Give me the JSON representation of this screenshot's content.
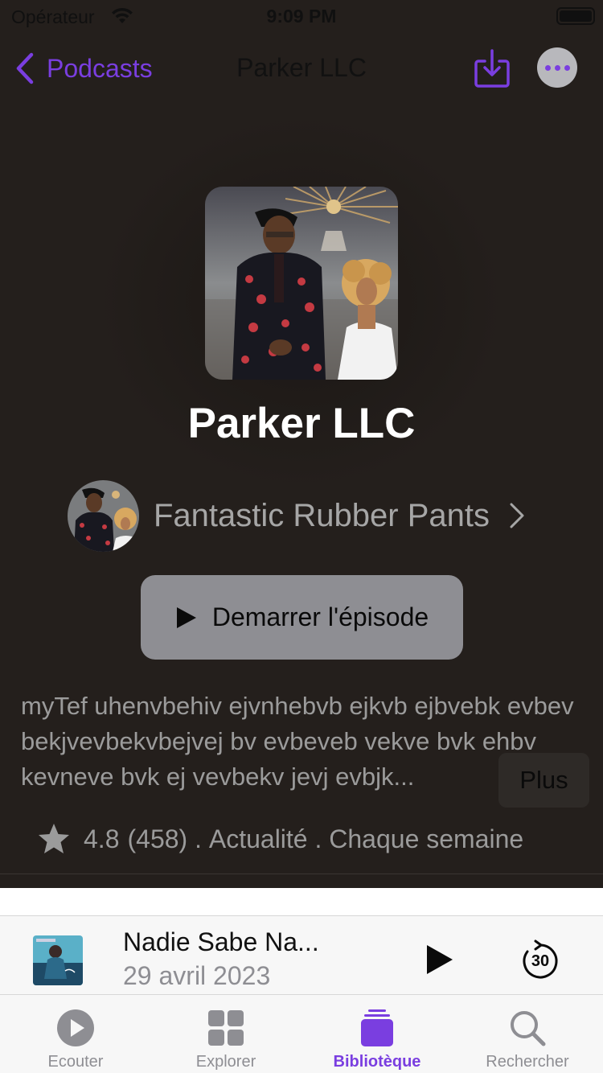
{
  "status_bar": {
    "carrier": "Opérateur",
    "time": "9:09 PM"
  },
  "nav": {
    "back_label": "Podcasts",
    "title": "Parker LLC"
  },
  "podcast": {
    "title": "Parker LLC",
    "author": "Fantastic Rubber Pants",
    "play_label": "Demarrer l'épisode",
    "description": "myTef uhenvbehiv ejvnhebvb ejkvb ejbvebk evbev bekjvevbekvbejvej bv evbeveb vekve bvk ehbv kevneve bvk ej vevbekv jevj evbjk...",
    "more_label": "Plus",
    "rating": "4.8",
    "rating_count": "(458)",
    "separator_1": " . ",
    "category": "Actualité",
    "separator_2": " . ",
    "frequency": "Chaque semaine"
  },
  "mini_player": {
    "title": "Nadie Sabe Na...",
    "date": "29 avril 2023",
    "skip_seconds": "30"
  },
  "tabs": [
    {
      "label": "Ecouter",
      "icon": "play-circle-icon",
      "active": false
    },
    {
      "label": "Explorer",
      "icon": "grid-icon",
      "active": false
    },
    {
      "label": "Bibliotèque",
      "icon": "library-stack-icon",
      "active": true
    },
    {
      "label": "Rechercher",
      "icon": "search-icon",
      "active": false
    }
  ],
  "colors": {
    "accent": "#7a3ee0",
    "header_background": "#241f1c",
    "play_button": "#8e8e93"
  }
}
